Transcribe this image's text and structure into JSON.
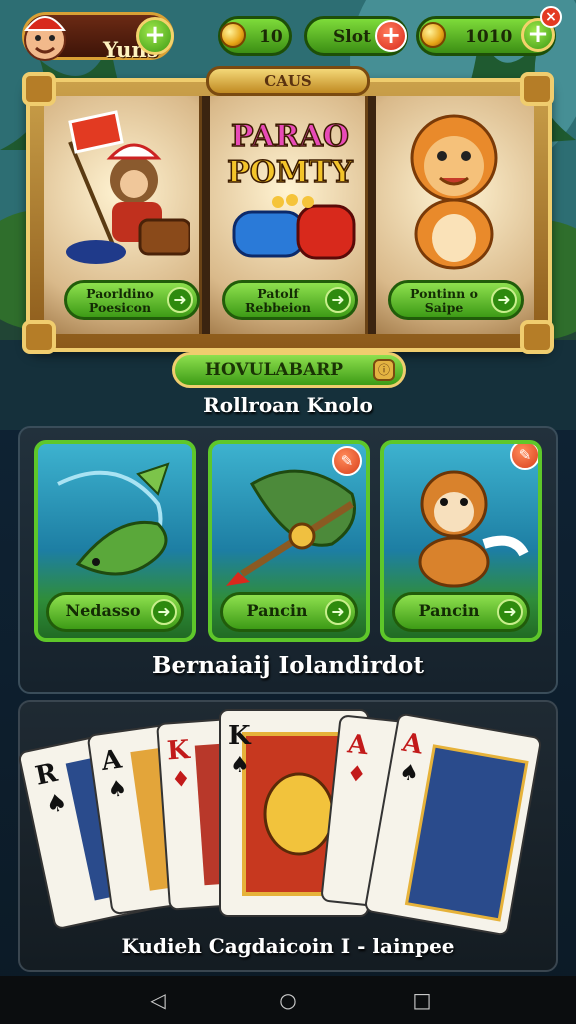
{
  "header": {
    "user_name": "Yuns",
    "coins": "10",
    "slot_label": "Slot",
    "gems": "1010",
    "notification_badge": "×"
  },
  "featured": {
    "frame_badge": "CAUS",
    "reel_logo_line1": "PARAO",
    "reel_logo_line2": "POMTY",
    "slots": [
      {
        "label_line1": "Paorldino",
        "label_line2": "Poesicon"
      },
      {
        "label_line1": "Patolf",
        "label_line2": "Rebbeion"
      },
      {
        "label_line1": "Pontinn o",
        "label_line2": "Saipe"
      }
    ],
    "title_button": "HOVULABARP",
    "subtitle": "Rollroan Knolo"
  },
  "fishing": {
    "cards": [
      {
        "label": "Nedasso"
      },
      {
        "label": "Pancin"
      },
      {
        "label": "Pancin"
      }
    ],
    "subtitle": "Bernaiaij Iolandirdot"
  },
  "cards_section": {
    "caption": "Kudieh Cagdaicoin I - lainpee",
    "card_ranks": [
      "R",
      "A",
      "K",
      "K",
      "A",
      "A"
    ]
  },
  "navbar": {
    "back": "◁",
    "home": "○",
    "recents": "□"
  },
  "colors": {
    "accent_green": "#5ec72a",
    "gold_frame": "#f0cd6e",
    "red_plus": "#d8291c"
  }
}
